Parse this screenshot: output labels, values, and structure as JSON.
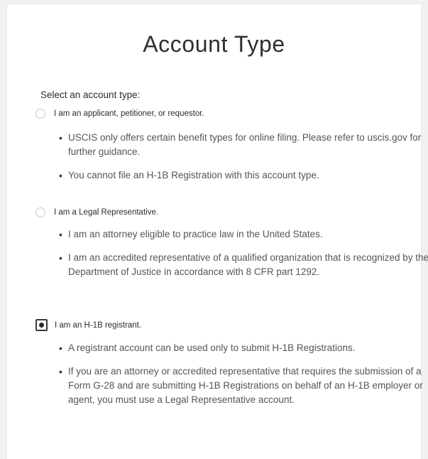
{
  "page": {
    "title": "Account Type",
    "prompt": "Select an account type:"
  },
  "options": [
    {
      "label": "I am an applicant, petitioner, or requestor.",
      "selected": false,
      "bullets": [
        "USCIS only offers certain benefit types for online filing. Please refer to uscis.gov for further guidance.",
        "You cannot file an H-1B Registration with this account type."
      ]
    },
    {
      "label": "I am a Legal Representative.",
      "selected": false,
      "bullets": [
        "I am an attorney eligible to practice law in the United States.",
        "I am an accredited representative of a qualified organization that is recognized by the Department of Justice in accordance with 8 CFR part 1292."
      ]
    },
    {
      "label": "I am an H-1B registrant.",
      "selected": true,
      "bullets": [
        "A registrant account can be used only to submit H-1B Registrations.",
        "If you are an attorney or accredited representative that requires the submission of a Form G-28 and are submitting H-1B Registrations on behalf of an H-1B employer or agent, you must use a Legal Representative account."
      ]
    }
  ]
}
